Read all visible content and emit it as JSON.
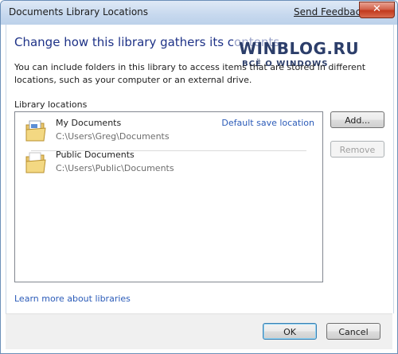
{
  "window": {
    "title": "Documents Library Locations",
    "send_feedback": "Send Feedback",
    "close_glyph": "✕"
  },
  "main": {
    "heading": "Change how this library gathers its contents",
    "description": "You can include folders in this library to access items that are stored in different locations, such as your computer or an external drive.",
    "section_label": "Library locations",
    "locations": [
      {
        "name": "My Documents",
        "path": "C:\\Users\\Greg\\Documents",
        "badge": "Default save location",
        "icon": "documents-folder-icon"
      },
      {
        "name": "Public Documents",
        "path": "C:\\Users\\Public\\Documents",
        "badge": "",
        "icon": "folder-icon"
      }
    ],
    "add_label": "Add...",
    "remove_label": "Remove",
    "learn_more": "Learn more about libraries"
  },
  "footer": {
    "ok_label": "OK",
    "cancel_label": "Cancel"
  },
  "watermark": {
    "title": "WINBLOG.RU",
    "subtitle": "ВСЁ О WINDOWS"
  },
  "colors": {
    "heading": "#1e3287",
    "link": "#2b5bb8",
    "titlebar": "#c6d8ee",
    "close": "#c2391d",
    "footer": "#f0f0f0"
  }
}
